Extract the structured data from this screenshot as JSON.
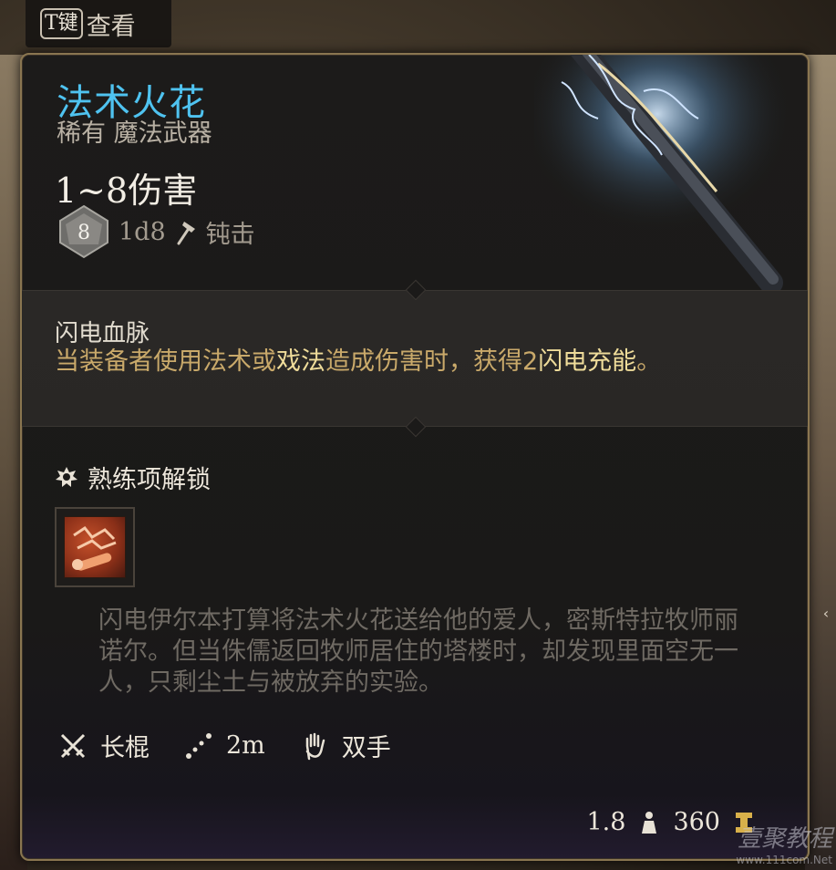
{
  "key_hint": {
    "key": "T键",
    "label": "查看"
  },
  "item": {
    "name": "法术火花",
    "rarity_type": "稀有 魔法武器",
    "damage": "1~8伤害",
    "dice_face": "8",
    "dice": "1d8",
    "damage_type": "钝击"
  },
  "trait": {
    "name": "闪电血脉",
    "desc_parts": [
      "当装备者使用法术或",
      "戏法",
      "造成伤害时，获得2",
      "闪电充能",
      "。"
    ]
  },
  "proficiency": {
    "label": "熟练项解锁"
  },
  "lore": "闪电伊尔本打算将法术火花送给他的爱人，密斯特拉牧师丽诺尔。但当侏儒返回牧师居住的塔楼时，却发现里面空无一人，只剩尘土与被放弃的实验。",
  "properties": {
    "weapon_type": "长棍",
    "range": "2m",
    "handedness": "双手"
  },
  "footer": {
    "weight": "1.8",
    "price": "360"
  },
  "watermark": {
    "brand": "壹聚教程",
    "url": "www.111com.Net"
  },
  "colors": {
    "title": "#4fc3f0",
    "highlight": "#efdc9a",
    "trait_text": "#c9a96a",
    "border": "#8a7650"
  }
}
